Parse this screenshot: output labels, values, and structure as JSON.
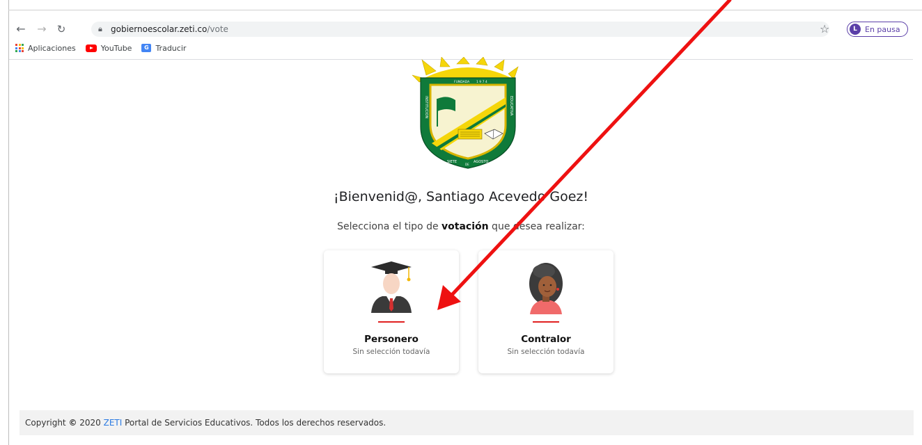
{
  "browser": {
    "url_host": "gobiernoescolar.zeti.co",
    "url_path": "/vote",
    "profile_initial": "L",
    "profile_status": "En pausa",
    "bookmarks": [
      "Aplicaciones",
      "YouTube",
      "Traducir"
    ]
  },
  "crest": {
    "ring_top": "FUNDADA",
    "ring_year": "1 9 7 4",
    "ring_left": "INSTITUCION",
    "ring_right": "EDUCATIVA",
    "ring_bottom_left": "SIETE",
    "ring_bottom_mid": "DE",
    "ring_bottom_right": "AGOSTO"
  },
  "page": {
    "welcome": "¡Bienvenid@, Santiago Acevedo Goez!",
    "instruction_before": "Selecciona el tipo de ",
    "instruction_bold": "votación",
    "instruction_after": " que desea realizar:"
  },
  "cards": [
    {
      "title": "Personero",
      "status": "Sin selección todavía",
      "icon": "graduate-avatar-icon"
    },
    {
      "title": "Contralor",
      "status": "Sin selección todavía",
      "icon": "woman-avatar-icon"
    }
  ],
  "footer": {
    "before": "Copyright ",
    "symbol": "©",
    "year": " 2020 ",
    "brand": "ZETI",
    "after": " Portal de Servicios Educativos. Todos los derechos reservados."
  },
  "colors": {
    "accent_red": "#e02020",
    "brand_blue": "#2a7ae2",
    "crest_green": "#0f7a3a",
    "crest_yellow": "#f5d60a",
    "profile_purple": "#5b3fa8"
  }
}
